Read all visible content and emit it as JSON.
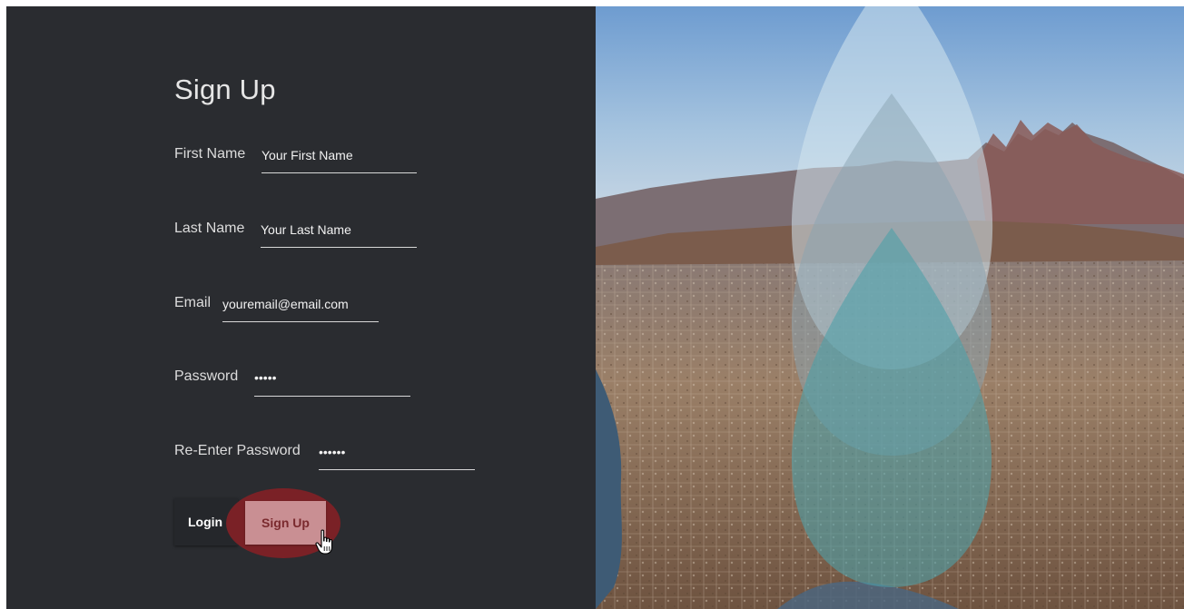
{
  "form": {
    "title": "Sign Up",
    "first_name": {
      "label": "First Name",
      "value": "Your First Name"
    },
    "last_name": {
      "label": "Last Name",
      "value": "Your Last Name"
    },
    "email": {
      "label": "Email",
      "value": "youremail@email.com"
    },
    "password": {
      "label": "Password",
      "value": "•••••"
    },
    "reenter_password": {
      "label": "Re-Enter Password",
      "value": "••••••"
    }
  },
  "buttons": {
    "login_label": "Login",
    "signup_label": "Sign Up"
  },
  "icons": {
    "cursor": "hand-pointer-icon"
  },
  "colors": {
    "panel_bg": "#2a2c30",
    "highlight": "#7a2126",
    "signup_button": "#c98f93",
    "drop_light": "#c8dde6",
    "drop_teal": "#5a9ea6"
  }
}
